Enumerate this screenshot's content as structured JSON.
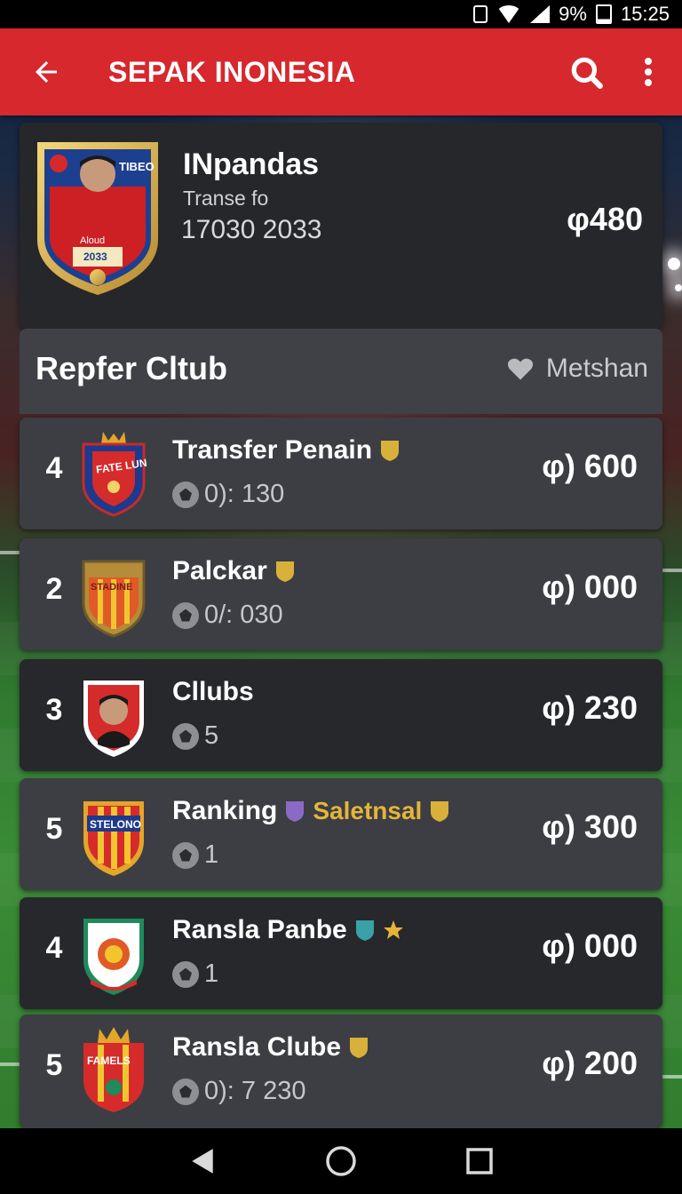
{
  "status_bar": {
    "battery": "9%",
    "time": "15:25",
    "icons": [
      "sim-icon",
      "wifi-icon",
      "signal-icon",
      "battery-icon"
    ]
  },
  "app_bar": {
    "title": "SEPAK INONESIA",
    "back_icon": "arrow-left-icon",
    "search_icon": "search-icon",
    "more_icon": "more-vert-icon",
    "color": "#d6282d"
  },
  "profile": {
    "name": "INpandas",
    "subtitle": "Transe fo",
    "dates": "17030 2033",
    "value": "φ480",
    "badge_text": "TIBEO",
    "badge_caption": "Aloud 2033"
  },
  "section": {
    "title": "Repfer Cltub",
    "action_label": "Metshan",
    "action_icon": "heart-icon"
  },
  "clubs": [
    {
      "rank": "4",
      "name": "Transfer Penain",
      "tag": "",
      "meta": "0): 130",
      "value": "φ) 600",
      "crest_text": "FATE LUN",
      "style": "light"
    },
    {
      "rank": "2",
      "name": "Palckar",
      "tag": "",
      "meta": "0/: 030",
      "value": "φ) 000",
      "crest_text": "STADINE",
      "style": "light"
    },
    {
      "rank": "3",
      "name": "Cllubs",
      "tag": "",
      "meta": "5",
      "value": "φ) 230",
      "crest_text": "",
      "style": "dark"
    },
    {
      "rank": "5",
      "name": "Ranking",
      "tag": "Saletnsal",
      "meta": "1",
      "value": "φ) 300",
      "crest_text": "STELONO",
      "style": "light"
    },
    {
      "rank": "4",
      "name": "Ransla Panbe",
      "tag": "",
      "meta": "1",
      "value": "φ) 000",
      "crest_text": "",
      "style": "dark"
    },
    {
      "rank": "5",
      "name": "Ransla Clube",
      "tag": "",
      "meta": "0): 7 230",
      "value": "φ) 200",
      "crest_text": "FAMELS",
      "style": "light"
    }
  ],
  "nav_bar": {
    "back_icon": "triangle-back-icon",
    "home_icon": "circle-home-icon",
    "recents_icon": "square-recents-icon"
  }
}
